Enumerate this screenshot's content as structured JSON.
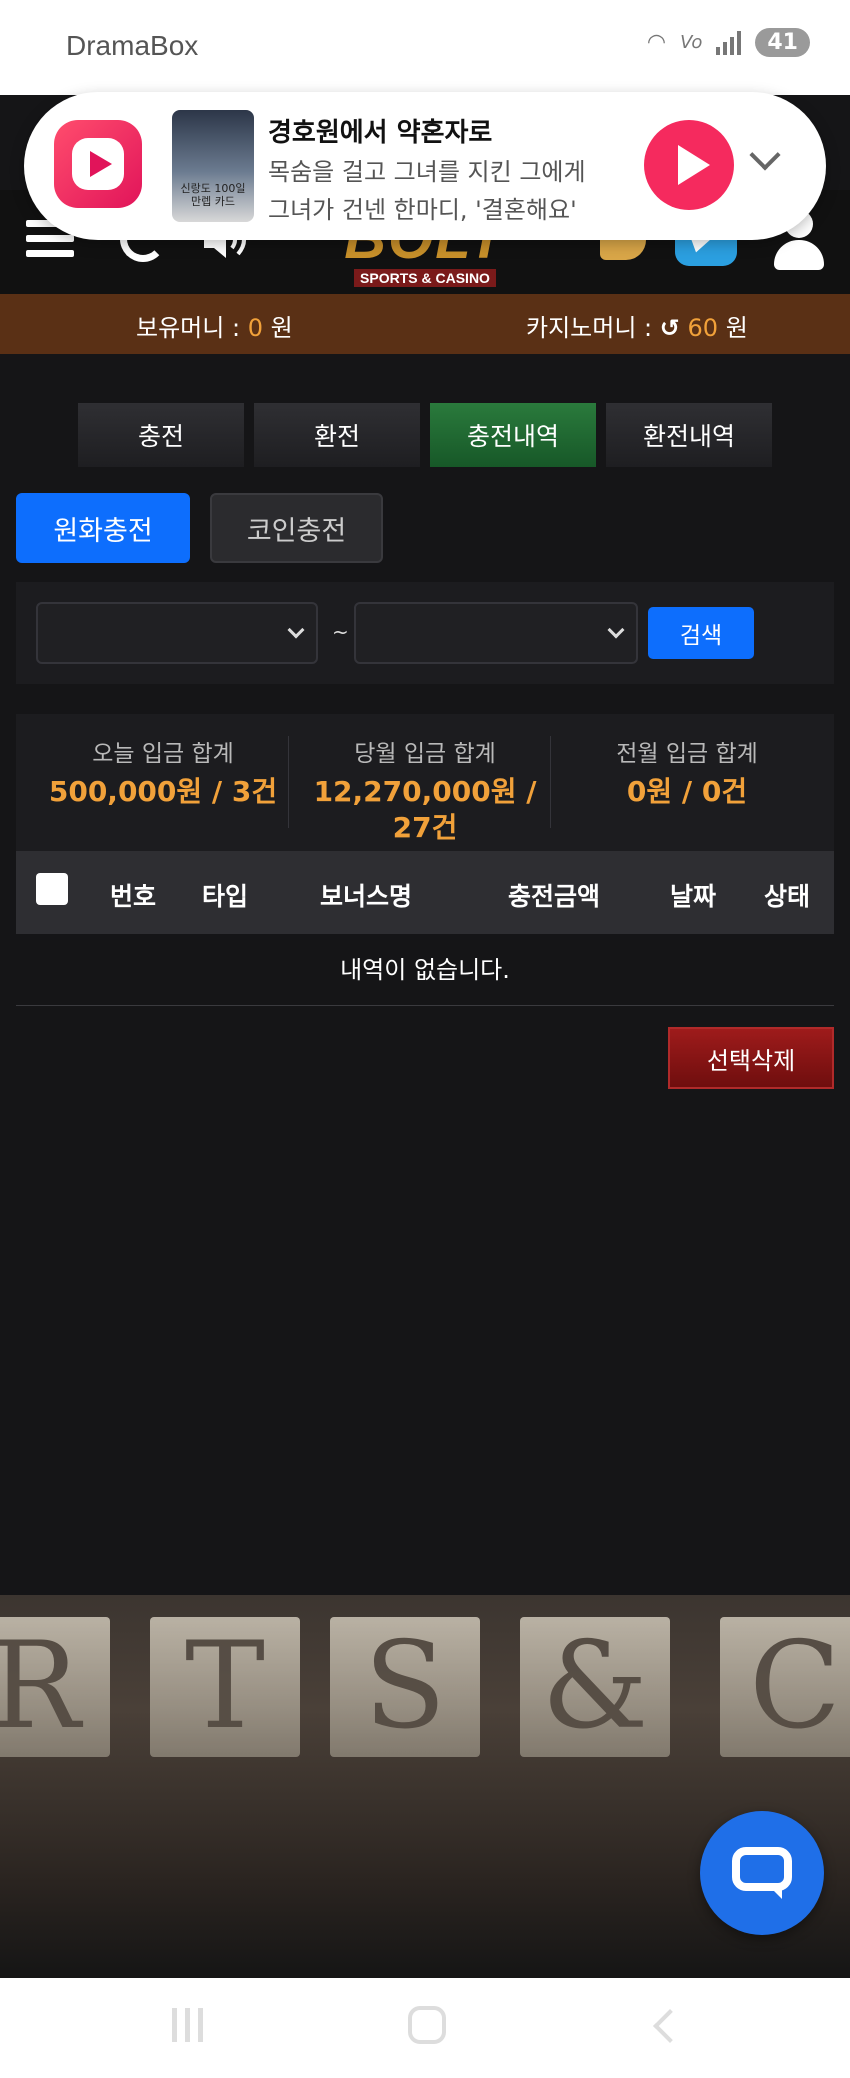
{
  "status_bar": {
    "app_name": "DramaBox",
    "battery": "41"
  },
  "notification": {
    "title": "경호원에서 약혼자로",
    "line1": "목숨을 걸고 그녀를 지킨 그에게",
    "line2": "그녀가 건넨 한마디, '결혼해요'",
    "thumb_text": "신랑도 100일 만렙 카드"
  },
  "header": {
    "logo_main": "BOLT",
    "logo_sub": "SPORTS & CASINO"
  },
  "balance": {
    "money_label": "보유머니 :",
    "money_value": "0",
    "money_unit": "원",
    "casino_label": "카지노머니 :",
    "casino_value": "60",
    "casino_unit": "원"
  },
  "tabs": [
    {
      "label": "충전"
    },
    {
      "label": "환전"
    },
    {
      "label": "충전내역"
    },
    {
      "label": "환전내역"
    }
  ],
  "type_buttons": {
    "krw": "원화충전",
    "coin": "코인충전"
  },
  "search": {
    "tilde": "~",
    "button": "검색"
  },
  "summary": [
    {
      "label": "오늘 입금 합계",
      "value": "500,000원 / 3건"
    },
    {
      "label": "당월 입금 합계",
      "value": "12,270,000원 / 27건"
    },
    {
      "label": "전월 입금 합계",
      "value": "0원 / 0건"
    }
  ],
  "table": {
    "columns": [
      "번호",
      "타입",
      "보너스명",
      "충전금액",
      "날짜",
      "상태"
    ],
    "empty_message": "내역이 없습니다."
  },
  "delete_button": "선택삭제",
  "background_letters": [
    "R",
    "T",
    "S",
    "&",
    "C"
  ],
  "colors": {
    "accent_blue": "#0d6efd",
    "active_tab_green": "#2a7a3c",
    "highlight_orange": "#f1a13a",
    "balance_bar": "#5a3015",
    "delete_red": "#9e1b1b"
  }
}
